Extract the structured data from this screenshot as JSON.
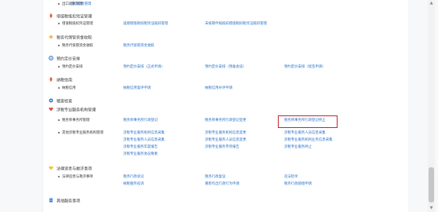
{
  "sections": [
    {
      "key": "top",
      "title": "",
      "sub": "出口退税管理",
      "links": [
        {
          "text": "出口退税管理"
        }
      ]
    },
    {
      "key": "s1",
      "title": "增值税抵扣凭证管理",
      "icon": "flame-icon",
      "color": "#e8593c",
      "sub": "增值税抵扣凭证管理",
      "links": [
        {
          "text": "逾期增值税扣税凭证抵扣管理"
        },
        {
          "text": "未按期申报抵扣增值税扣税凭证抵扣管理"
        }
      ]
    },
    {
      "key": "s2",
      "title": "税务代保管资金收取",
      "icon": "sun-icon",
      "color": "#f2a52b",
      "sub": "税务代保管资金收取",
      "links": [
        {
          "text": "税务代保管资金收取"
        }
      ]
    },
    {
      "key": "s3",
      "title": "预约定价安排",
      "icon": "gear-icon",
      "color": "#3a7bd5",
      "sub": "预约定价安排",
      "links": [
        {
          "text": "预约定价安排（正式申请）"
        },
        {
          "text": "预约定价安排（预备会谈）"
        },
        {
          "text": "预约定价安排（续签申请）"
        }
      ]
    },
    {
      "key": "s4",
      "title": "纳税信用",
      "icon": "flame-icon",
      "color": "#e8593c",
      "sub": "纳税信用",
      "links": [
        {
          "text": "纳税信用复评申请"
        },
        {
          "text": "纳税信用补评申请"
        }
      ]
    },
    {
      "key": "s5",
      "title": "稽查检查",
      "icon": "circle-icon",
      "color": "#2f6fc9"
    },
    {
      "key": "s6",
      "title": "涉税专业服务机构管理",
      "icon": "heart-icon",
      "color": "#e34a4a"
    },
    {
      "key": "s6a",
      "sub": "税务师事务所管理",
      "links": [
        {
          "text": "税务师事务所行政登记"
        },
        {
          "text": "税务师事务所行政登记变更"
        },
        {
          "text": "税务师事务所行政登记终止"
        }
      ]
    },
    {
      "key": "s6b",
      "sub": "其他涉税专业服务机构管理",
      "links": [
        {
          "text": "涉税专业服务机构信息采集"
        },
        {
          "text": "涉税专业服务机构信息变更"
        },
        {
          "text": "涉税专业服务人员信息采集"
        },
        {
          "text": "涉税专业服务人员信息采集"
        },
        {
          "text": "涉税专业服务人员信息变更"
        },
        {
          "text": "涉税专业服务机构业务信息采集"
        },
        {
          "text": "涉税专业服务年度报告"
        },
        {
          "text": "涉税专业服务专项报告"
        },
        {
          "text": "涉税专业服务终止"
        },
        {
          "text": "涉税专业服务协议要素"
        }
      ]
    },
    {
      "key": "s7",
      "title": "法律追责与救济事项",
      "icon": "heart-icon",
      "color": "#f2c230",
      "sub": "法律追责与救济事项",
      "links": [
        {
          "text": "税务行政诉讼"
        },
        {
          "text": "税务行政复议"
        },
        {
          "text": "违法检举"
        },
        {
          "text": "纳税服务投诉"
        },
        {
          "text": "重新作出行政行为申请"
        },
        {
          "text": "税务行政赔偿申请"
        }
      ]
    },
    {
      "key": "s8",
      "title": "其他服务事项",
      "icon": "doc-icon",
      "color": "#3a7bd5"
    }
  ],
  "highlight_label": "税务师事务所行政登记终止"
}
